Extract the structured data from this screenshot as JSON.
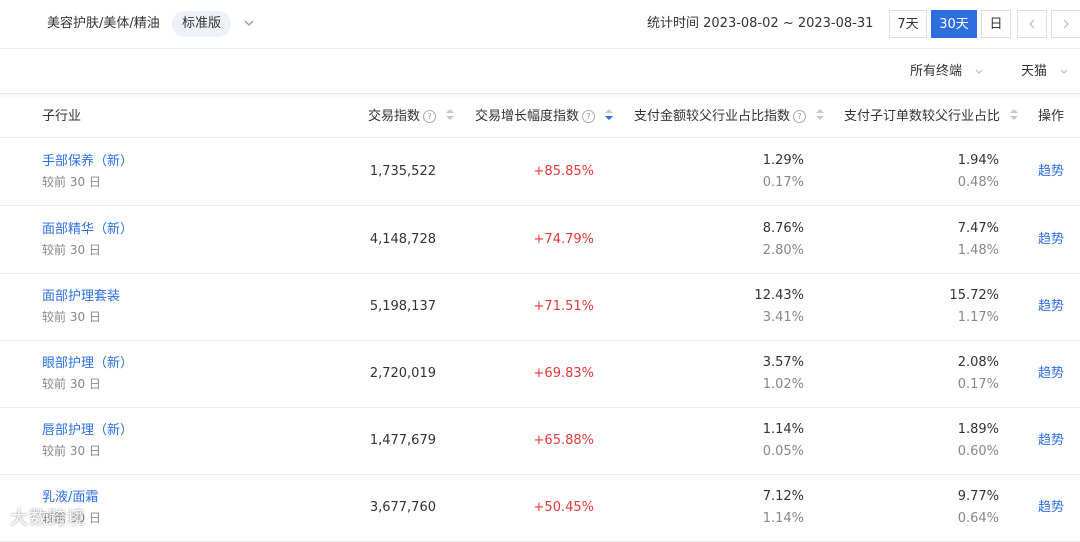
{
  "header": {
    "category": "美容护肤/美体/精油",
    "edition": "标准版",
    "date_range": "统计时间 2023-08-02 ~ 2023-08-31",
    "buttons": {
      "seven_days": "7天",
      "thirty_days": "30天",
      "day": "日"
    }
  },
  "filters": {
    "terminal": "所有终端",
    "platform": "天猫"
  },
  "table": {
    "columns": [
      "子行业",
      "交易指数",
      "交易增长幅度指数",
      "支付金额较父行业占比指数",
      "支付子订单数较父行业占比",
      "操作"
    ],
    "rows": [
      {
        "name": "手部保养（新）",
        "sub": "较前 30 日",
        "index": "1,735,522",
        "growth": "+85.85%",
        "pay_amount": "1.29%",
        "pay_amount_prev": "0.17%",
        "pay_orders": "1.94%",
        "pay_orders_prev": "0.48%",
        "action": "趋势"
      },
      {
        "name": "面部精华（新）",
        "sub": "较前 30 日",
        "index": "4,148,728",
        "growth": "+74.79%",
        "pay_amount": "8.76%",
        "pay_amount_prev": "2.80%",
        "pay_orders": "7.47%",
        "pay_orders_prev": "1.48%",
        "action": "趋势"
      },
      {
        "name": "面部护理套装",
        "sub": "较前 30 日",
        "index": "5,198,137",
        "growth": "+71.51%",
        "pay_amount": "12.43%",
        "pay_amount_prev": "3.41%",
        "pay_orders": "15.72%",
        "pay_orders_prev": "1.17%",
        "action": "趋势"
      },
      {
        "name": "眼部护理（新）",
        "sub": "较前 30 日",
        "index": "2,720,019",
        "growth": "+69.83%",
        "pay_amount": "3.57%",
        "pay_amount_prev": "1.02%",
        "pay_orders": "2.08%",
        "pay_orders_prev": "0.17%",
        "action": "趋势"
      },
      {
        "name": "唇部护理（新）",
        "sub": "较前 30 日",
        "index": "1,477,679",
        "growth": "+65.88%",
        "pay_amount": "1.14%",
        "pay_amount_prev": "0.05%",
        "pay_orders": "1.89%",
        "pay_orders_prev": "0.60%",
        "action": "趋势"
      },
      {
        "name": "乳液/面霜",
        "sub": "较前 30 日",
        "index": "3,677,760",
        "growth": "+50.45%",
        "pay_amount": "7.12%",
        "pay_amount_prev": "1.14%",
        "pay_orders": "9.77%",
        "pay_orders_prev": "0.64%",
        "action": "趋势"
      }
    ]
  },
  "watermark": "大数跨境",
  "colors": {
    "accent": "#2e6fe0",
    "positive": "#e4393c",
    "muted": "#888888"
  }
}
